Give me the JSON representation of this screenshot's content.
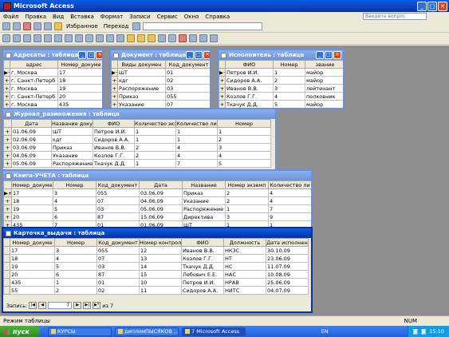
{
  "app": {
    "title": "Microsoft Access",
    "help_search_placeholder": "Введите вопрос"
  },
  "menu": [
    "Файл",
    "Правка",
    "Вид",
    "Вставка",
    "Формат",
    "Записи",
    "Сервис",
    "Окно",
    "Справка"
  ],
  "toolbar": {
    "favorites_label": "Избранное",
    "goto_label": "Переход"
  },
  "windows": {
    "addresses": {
      "title": "Адресаты : таблица",
      "columns": [
        "адрес",
        "Номер_докуме"
      ],
      "rows": [
        [
          "г. Москва",
          "17"
        ],
        [
          "г. Санкт-Петерб",
          "18"
        ],
        [
          "г. Москва",
          "19"
        ],
        [
          "г. Санкт-Петерб",
          "20"
        ],
        [
          "г. Москва",
          "435"
        ]
      ]
    },
    "document": {
      "title": "Документ : таблица",
      "columns": [
        "Виды докумен",
        "Код_документ"
      ],
      "rows": [
        [
          "ШТ",
          "01"
        ],
        [
          "кдг",
          "02"
        ],
        [
          "Распоряжение",
          "03"
        ],
        [
          "Приказ",
          "055"
        ],
        [
          "Указание",
          "07"
        ]
      ]
    },
    "executor": {
      "title": "Исполнитель : таблица",
      "columns": [
        "ФИО",
        "Номер",
        "звание"
      ],
      "rows": [
        [
          "Петров И.И.",
          "1",
          "майор"
        ],
        [
          "Сидоров А.А.",
          "2",
          "майор"
        ],
        [
          "Иванов В.В.",
          "3",
          "лейтенант"
        ],
        [
          "Козлов Г.Г.",
          "4",
          "полковник"
        ],
        [
          "Ткачук Д.Д.",
          "5",
          "майор"
        ]
      ]
    },
    "journal": {
      "title": "Журнал_размножения : таблица",
      "columns": [
        "Дата",
        "Название доку",
        "ФИО",
        "Количество экз",
        "Количество ли",
        "Номер"
      ],
      "rows": [
        [
          "01.06.09",
          "ШТ",
          "Петров И.И.",
          "1",
          "1",
          "1"
        ],
        [
          "02.06.09",
          "кдг",
          "Сидоров А.А.",
          "1",
          "1",
          "2"
        ],
        [
          "03.06.09",
          "Приказ",
          "Иванов В.В.",
          "2",
          "4",
          "3"
        ],
        [
          "04.06.09",
          "Указание",
          "Козлов Г.Г.",
          "2",
          "4",
          "4"
        ],
        [
          "05.06.09",
          "Распоряжение",
          "Ткачук Д.Д.",
          "1",
          "7",
          "5"
        ]
      ]
    },
    "ledger": {
      "title": "Книга-УЧЕТА : таблица",
      "columns": [
        "Номер_докуме",
        "Номер",
        "Код_документ",
        "Дата",
        "Название",
        "Номер экземп",
        "Количество ли"
      ],
      "rows": [
        [
          "17",
          "3",
          "055",
          "03.06.09",
          "Приказ",
          "2",
          "4"
        ],
        [
          "18",
          "4",
          "07",
          "04.06.09",
          "Указание",
          "2",
          "4"
        ],
        [
          "19",
          "5",
          "03",
          "05.06.09",
          "Распоряжение",
          "1",
          "7"
        ],
        [
          "20",
          "6",
          "87",
          "15.06.09",
          "Директива",
          "3",
          "9"
        ],
        [
          "435",
          "7",
          "01",
          "01.06.09",
          "ШТ",
          "1",
          "1"
        ]
      ]
    },
    "card": {
      "title": "Карточка_выдачи : таблица",
      "columns": [
        "Номер_докуме",
        "Номер",
        "Код_документ",
        "Номер контрол",
        "ФИО",
        "Должность",
        "Дата исполнен"
      ],
      "rows": [
        [
          "17",
          "3",
          "055",
          "12",
          "Иванов В.В.",
          "НКЗС",
          "30.10.09"
        ],
        [
          "18",
          "4",
          "07",
          "13",
          "Козлов Г.Г.",
          "НТ",
          "23.06.09"
        ],
        [
          "19",
          "5",
          "03",
          "14",
          "Ткачук Д.Д.",
          "НС",
          "11.07.09"
        ],
        [
          "20",
          "6",
          "87",
          "15",
          "Лебович Е.Е.",
          "НАС",
          "10.08.09"
        ],
        [
          "435",
          "1",
          "01",
          "10",
          "Петров И.И.",
          "НРАВ",
          "25.06.09"
        ],
        [
          "55",
          "2",
          "02",
          "11",
          "Сидоров А.А.",
          "НИТС",
          "04.07.09"
        ]
      ],
      "nav": {
        "label": "Запись:",
        "current": "7",
        "of": "из 7"
      }
    }
  },
  "status": {
    "mode": "Режим таблицы",
    "num": "NUM"
  },
  "taskbar": {
    "start": "пуск",
    "items": [
      "КУРСЫ",
      "дипломПЫСЯКОВ ...",
      "7 Microsoft Access"
    ],
    "lang": "EN",
    "time": "15:10"
  }
}
